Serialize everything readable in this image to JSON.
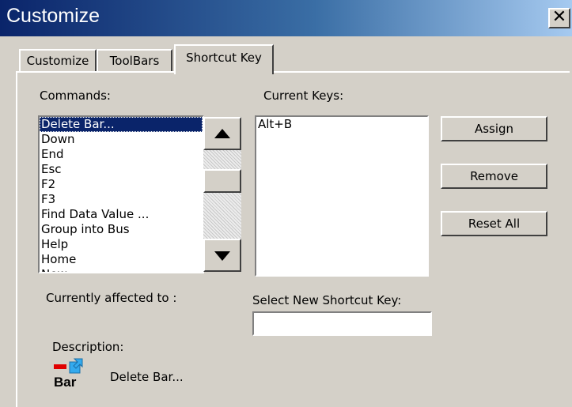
{
  "window": {
    "title": "Customize",
    "close_glyph": "✕"
  },
  "tabs": [
    {
      "label": "Customize",
      "active": false
    },
    {
      "label": "ToolBars",
      "active": false
    },
    {
      "label": "Shortcut Key",
      "active": true
    }
  ],
  "commands": {
    "label": "Commands:",
    "items": [
      "Delete Bar...",
      "Down",
      "End",
      "Esc",
      "F2",
      "F3",
      "Find Data Value ...",
      "Group into Bus",
      "Help",
      "Home",
      "New"
    ],
    "selected": "Delete Bar..."
  },
  "current_keys": {
    "label": "Current Keys:",
    "items": [
      "Alt+B"
    ]
  },
  "buttons": {
    "assign": "Assign",
    "remove": "Remove",
    "reset_all": "Reset All"
  },
  "affected_label": "Currently affected to :",
  "new_shortcut": {
    "label": "Select New Shortcut Key:",
    "value": ""
  },
  "description": {
    "label": "Description:",
    "text": "Delete Bar...",
    "icon": "delete-bar-icon",
    "icon_text": "Bar"
  },
  "colors": {
    "title_start": "#0a246a",
    "title_end": "#a6caf0",
    "selection": "#0a246a",
    "face": "#d4d0c8"
  }
}
